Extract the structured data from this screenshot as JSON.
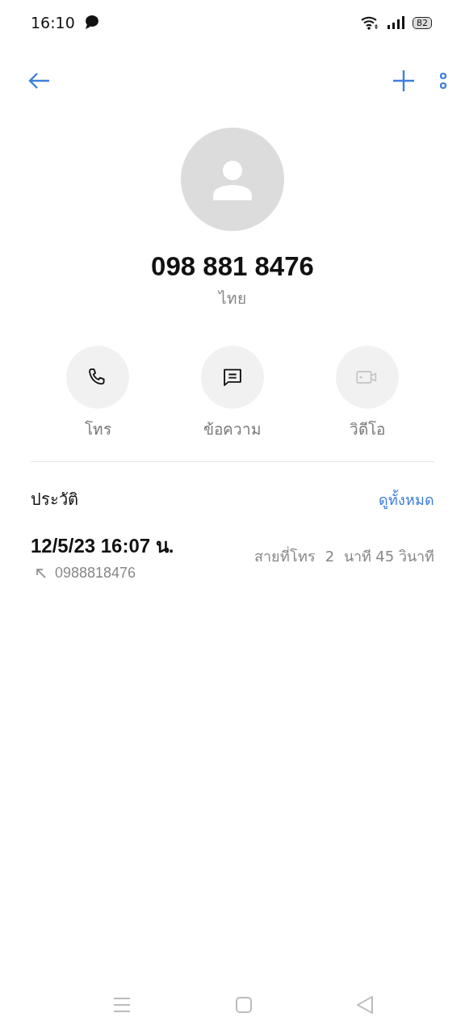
{
  "status_bar": {
    "time": "16:10",
    "battery": "82"
  },
  "contact": {
    "number": "098 881 8476",
    "location": "ไทย"
  },
  "actions": [
    {
      "kind": "call",
      "label": "โทร",
      "disabled": false
    },
    {
      "kind": "message",
      "label": "ข้อความ",
      "disabled": false
    },
    {
      "kind": "video",
      "label": "วิดีโอ",
      "disabled": true
    }
  ],
  "history": {
    "title": "ประวัติ",
    "link": "ดูทั้งหมด",
    "entries": [
      {
        "datetime": "12/5/23 16:07 น.",
        "number": "0988818476",
        "outgoing": true,
        "duration": "สายที่โทร  2  นาที 45 วินาที"
      }
    ]
  }
}
